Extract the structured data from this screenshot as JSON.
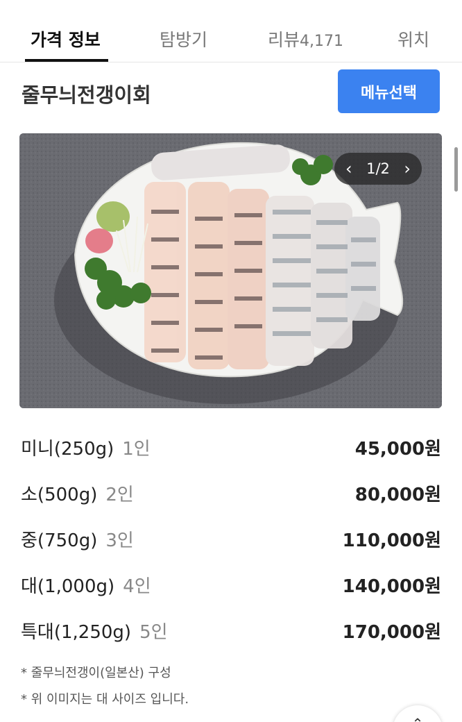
{
  "tabs": [
    {
      "label": "가격 정보",
      "active": true
    },
    {
      "label": "탐방기",
      "active": false
    },
    {
      "label": "리뷰",
      "count": "4,171",
      "active": false
    },
    {
      "label": "위치",
      "active": false
    }
  ],
  "menu": {
    "title": "줄무늬전갱이회",
    "select_button": "메뉴선택"
  },
  "gallery": {
    "current": "1/2",
    "prev_icon": "chevron-left-icon",
    "next_icon": "chevron-right-icon"
  },
  "prices": [
    {
      "name": "미니(250g)",
      "people": "1인",
      "price": "45,000원"
    },
    {
      "name": "소(500g)",
      "people": "2인",
      "price": "80,000원"
    },
    {
      "name": "중(750g)",
      "people": "3인",
      "price": "110,000원"
    },
    {
      "name": "대(1,000g)",
      "people": "4인",
      "price": "140,000원"
    },
    {
      "name": "특대(1,250g)",
      "people": "5인",
      "price": "170,000원"
    }
  ],
  "notes": [
    "* 줄무늬전갱이(일본산) 구성",
    "* 위 이미지는 대 사이즈 입니다."
  ],
  "colors": {
    "accent": "#3b82f0",
    "active_tab_underline": "#111111"
  }
}
